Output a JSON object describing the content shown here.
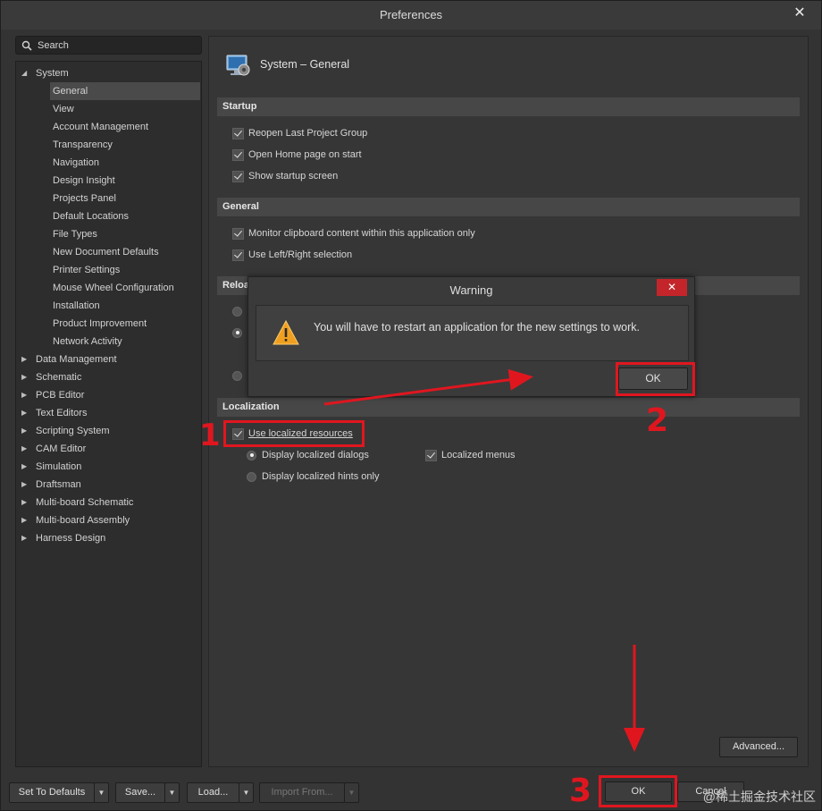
{
  "window": {
    "title": "Preferences",
    "close_glyph": "✕"
  },
  "search": {
    "placeholder": "Search"
  },
  "tree": {
    "system_label": "System",
    "system_children": [
      "General",
      "View",
      "Account Management",
      "Transparency",
      "Navigation",
      "Design Insight",
      "Projects Panel",
      "Default Locations",
      "File Types",
      "New Document Defaults",
      "Printer Settings",
      "Mouse Wheel Configuration",
      "Installation",
      "Product Improvement",
      "Network Activity"
    ],
    "selected": "General",
    "roots": [
      "Data Management",
      "Schematic",
      "PCB Editor",
      "Text Editors",
      "Scripting System",
      "CAM Editor",
      "Simulation",
      "Draftsman",
      "Multi-board Schematic",
      "Multi-board Assembly",
      "Harness Design"
    ]
  },
  "page": {
    "title": "System – General",
    "sections": {
      "startup": "Startup",
      "general": "General",
      "reload": "Reloa",
      "localization": "Localization"
    },
    "startup_options": [
      "Reopen Last Project Group",
      "Open Home page on start",
      "Show startup screen"
    ],
    "general_options": [
      "Monitor clipboard content within this application only",
      "Use Left/Right selection"
    ],
    "localization": {
      "use_localized": "Use localized resources",
      "display_dialogs": "Display localized dialogs",
      "hints_only": "Display localized hints only",
      "localized_menus": "Localized menus"
    },
    "advanced_button": "Advanced..."
  },
  "buttons": {
    "set_defaults": "Set To Defaults",
    "save": "Save...",
    "load": "Load...",
    "import": "Import From...",
    "ok": "OK",
    "cancel": "Cancel"
  },
  "warning": {
    "title": "Warning",
    "message": "You will have to restart an application for the new settings to work.",
    "ok": "OK",
    "close_glyph": "✕"
  },
  "annotations": {
    "step1": "1",
    "step2": "2",
    "step3": "3",
    "color": "#e0161f"
  },
  "watermark": "@稀土掘金技术社区"
}
